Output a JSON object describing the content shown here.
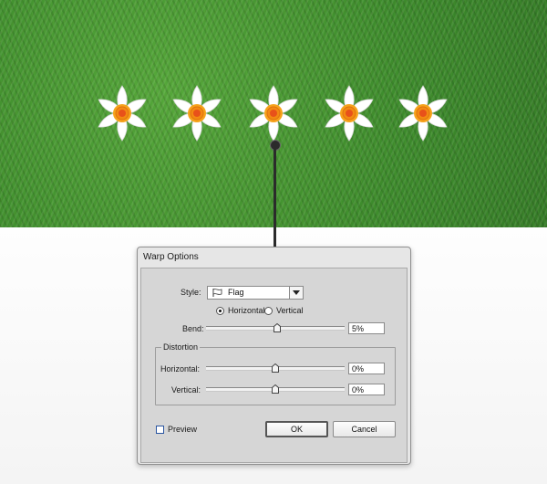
{
  "dialog": {
    "title": "Warp Options",
    "style_label": "Style:",
    "style_value": "Flag",
    "orientation": {
      "horizontal_label": "Horizontal",
      "vertical_label": "Vertical",
      "selected": "Horizontal"
    },
    "bend": {
      "label": "Bend:",
      "value": "5%",
      "slider_fraction": 0.525
    },
    "distortion": {
      "title": "Distortion",
      "horizontal": {
        "label": "Horizontal:",
        "value": "0%",
        "slider_fraction": 0.5
      },
      "vertical": {
        "label": "Vertical:",
        "value": "0%",
        "slider_fraction": 0.5
      }
    },
    "preview": {
      "label": "Preview",
      "checked": false
    },
    "ok_label": "OK",
    "cancel_label": "Cancel"
  },
  "artwork": {
    "flower_count": 5,
    "icon": "daffodil-flower-icon",
    "colors": {
      "grass": "#3f8f2f",
      "petal": "#ffffff",
      "flower_center": "#f28a12",
      "flower_core": "#e8511a"
    }
  }
}
